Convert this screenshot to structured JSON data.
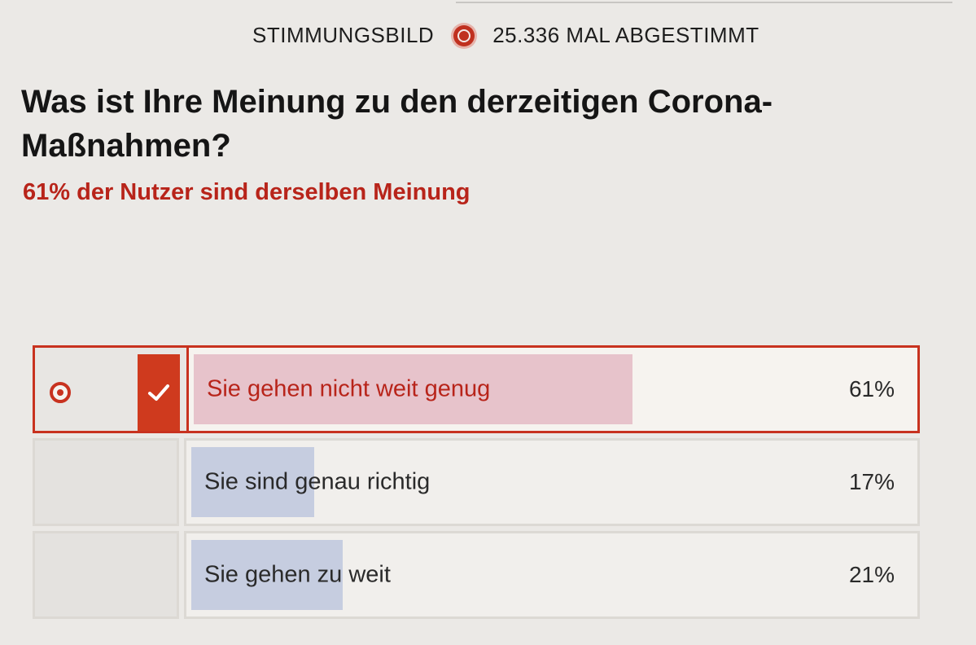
{
  "poll": {
    "header_label": "STIMMUNGSBILD",
    "vote_count_text": "25.336 MAL ABGESTIMMT",
    "question": "Was ist Ihre Meinung zu den derzeitigen Corona-Maßnahmen?",
    "summary": "61% der Nutzer sind derselben Meinung"
  },
  "options": [
    {
      "label": "Sie gehen nicht weit genug",
      "percent_text": "61%",
      "percent": 61,
      "selected": true
    },
    {
      "label": "Sie sind genau richtig",
      "percent_text": "17%",
      "percent": 17,
      "selected": false
    },
    {
      "label": "Sie gehen zu weit",
      "percent_text": "21%",
      "percent": 21,
      "selected": false
    }
  ],
  "colors": {
    "accent": "#c8321f",
    "selected_bar": "#e7c3cb",
    "default_bar": "#c6cde0",
    "background": "#ebe9e6"
  },
  "icons": {
    "live": "live-indicator-icon",
    "radio": "radio-selected-icon",
    "check": "checkmark-icon"
  }
}
